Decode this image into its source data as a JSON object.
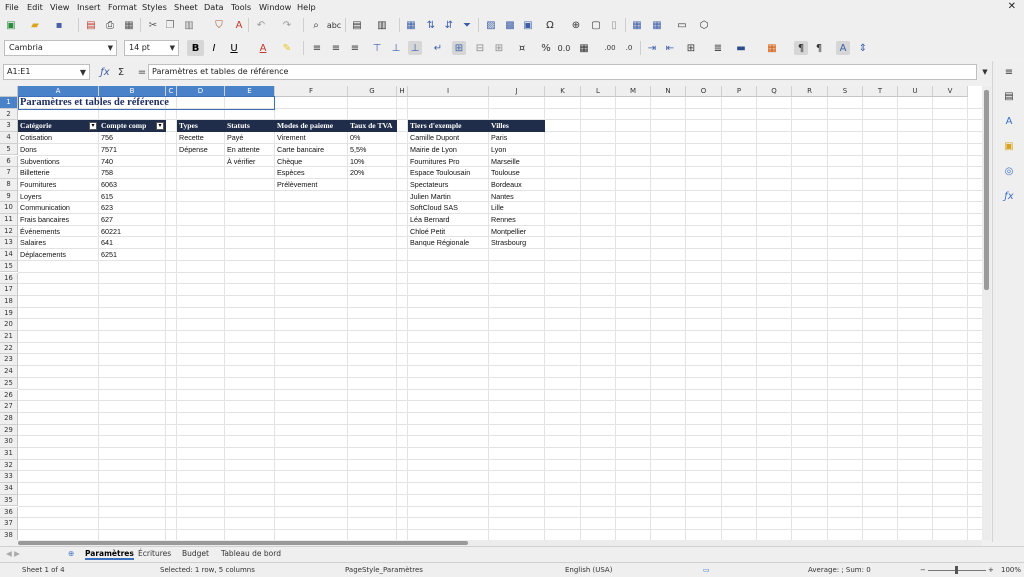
{
  "menu": [
    "File",
    "Edit",
    "View",
    "Insert",
    "Format",
    "Styles",
    "Sheet",
    "Data",
    "Tools",
    "Window",
    "Help"
  ],
  "toolbar": {
    "font_name": "Cambria",
    "font_size": "14 pt"
  },
  "formula_bar": {
    "name_box": "A1:E1",
    "fx_symbol": "ƒx",
    "sum_symbol": "Σ",
    "equals_symbol": "=",
    "content": "Paramètres et tables de référence"
  },
  "columns": [
    "A",
    "B",
    "C",
    "D",
    "E",
    "F",
    "G",
    "H",
    "I",
    "J",
    "K",
    "L",
    "M",
    "N",
    "O",
    "P",
    "Q",
    "R",
    "S",
    "T",
    "U",
    "V"
  ],
  "rows": [
    "1",
    "2",
    "3",
    "4",
    "5",
    "6",
    "7",
    "8",
    "9",
    "10",
    "11",
    "12",
    "13",
    "14",
    "15",
    "16",
    "17",
    "18",
    "19",
    "20",
    "21",
    "22",
    "23",
    "24",
    "25",
    "26",
    "27",
    "28",
    "29",
    "30",
    "31",
    "32",
    "33",
    "34",
    "35",
    "36",
    "37",
    "38"
  ],
  "sheet": {
    "title": "Paramètres et tables de référence",
    "categories": {
      "header_category": "Catégorie",
      "header_account": "Compte comp",
      "rows": [
        {
          "category": "Cotisation",
          "account": "756"
        },
        {
          "category": "Dons",
          "account": "7571"
        },
        {
          "category": "Subventions",
          "account": "740"
        },
        {
          "category": "Billetterie",
          "account": "758"
        },
        {
          "category": "Fournitures",
          "account": "6063"
        },
        {
          "category": "Loyers",
          "account": "615"
        },
        {
          "category": "Communication",
          "account": "623"
        },
        {
          "category": "Frais bancaires",
          "account": "627"
        },
        {
          "category": "Événements",
          "account": "60221"
        },
        {
          "category": "Salaires",
          "account": "641"
        },
        {
          "category": "Déplacements",
          "account": "6251"
        }
      ]
    },
    "types": {
      "header": "Types",
      "values": [
        "Recette",
        "Dépense"
      ]
    },
    "statuts": {
      "header": "Statuts",
      "values": [
        "Payé",
        "En attente",
        "À vérifier"
      ]
    },
    "modes": {
      "header": "Modes de paieme",
      "values": [
        "Virement",
        "Carte bancaire",
        "Chèque",
        "Espèces",
        "Prélèvement"
      ]
    },
    "tva": {
      "header": "Taux de TVA",
      "values": [
        "0%",
        "5,5%",
        "10%",
        "20%"
      ]
    },
    "tiers": {
      "header": "Tiers d'exemple",
      "values": [
        "Camille Dupont",
        "Mairie de Lyon",
        "Fournitures Pro",
        "Espace Toulousain",
        "Spectateurs",
        "Julien Martin",
        "SoftCloud SAS",
        "Léa Bernard",
        "Chloé Petit",
        "Banque Régionale"
      ]
    },
    "villes": {
      "header": "Villes",
      "values": [
        "Paris",
        "Lyon",
        "Marseille",
        "Toulouse",
        "Bordeaux",
        "Nantes",
        "Lille",
        "Rennes",
        "Montpellier",
        "Strasbourg"
      ]
    }
  },
  "tabs": [
    "Paramètres",
    "Écritures",
    "Budget",
    "Tableau de bord"
  ],
  "status": {
    "sheet_info": "Sheet 1 of 4",
    "selection": "Selected: 1 row, 5 columns",
    "page_style": "PageStyle_Paramètres",
    "language": "English (USA)",
    "stats": "Average: ; Sum: 0",
    "zoom": "100%"
  }
}
